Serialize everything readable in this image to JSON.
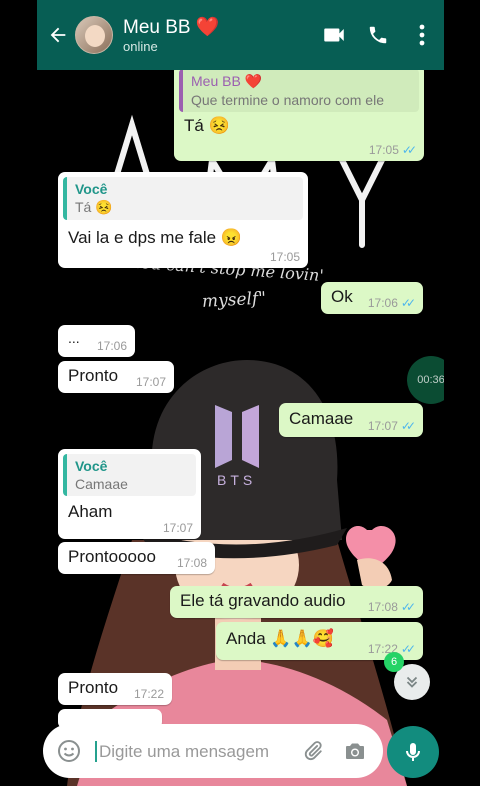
{
  "header": {
    "contact_name": "Meu BB ❤️",
    "status": "online"
  },
  "messages": [
    {
      "id": "m1",
      "dir": "out",
      "quote": {
        "author": "Meu BB ❤️",
        "text": "Que termine o namoro com ele"
      },
      "text": "Tá 😣",
      "time": "17:05",
      "read": true
    },
    {
      "id": "m2",
      "dir": "in",
      "quote": {
        "author": "Você",
        "text": "Tá 😣"
      },
      "text": "Vai la e dps me fale 😠",
      "time": "17:05"
    },
    {
      "id": "m3",
      "dir": "out",
      "text": "Ok",
      "time": "17:06",
      "read": true
    },
    {
      "id": "m4",
      "dir": "in",
      "text": "...",
      "time": "17:06"
    },
    {
      "id": "m5",
      "dir": "in",
      "text": "Pronto",
      "time": "17:07"
    },
    {
      "id": "m6",
      "dir": "out",
      "text": "Camaae",
      "time": "17:07",
      "read": true
    },
    {
      "id": "m7",
      "dir": "in",
      "quote": {
        "author": "Você",
        "text": "Camaae"
      },
      "text": "Aham",
      "time": "17:07"
    },
    {
      "id": "m8",
      "dir": "in",
      "text": "Prontooooo",
      "time": "17:08"
    },
    {
      "id": "m9",
      "dir": "out",
      "text": "Ele tá gravando audio",
      "time": "17:08",
      "read": true
    },
    {
      "id": "m10",
      "dir": "out",
      "text": "Anda 🙏🙏🥰",
      "time": "17:22",
      "read": true
    },
    {
      "id": "m11",
      "dir": "in",
      "text": "Pronto",
      "time": "17:22"
    }
  ],
  "voice_bubble": {
    "duration": "00:36"
  },
  "scroll": {
    "unread_count": "6"
  },
  "input": {
    "placeholder": "Digite uma mensagem"
  },
  "wallpaper": {
    "big_text": "ARMY",
    "script_line1": "You can't stop me lovin'",
    "script_line2": "myself\"",
    "cap_logo_text": "BTS"
  },
  "colors": {
    "header": "#075e54",
    "outgoing_bubble": "#dcf8c6",
    "incoming_bubble": "#ffffff",
    "accent": "#128c7e",
    "read_ticks": "#4fb6ec"
  }
}
